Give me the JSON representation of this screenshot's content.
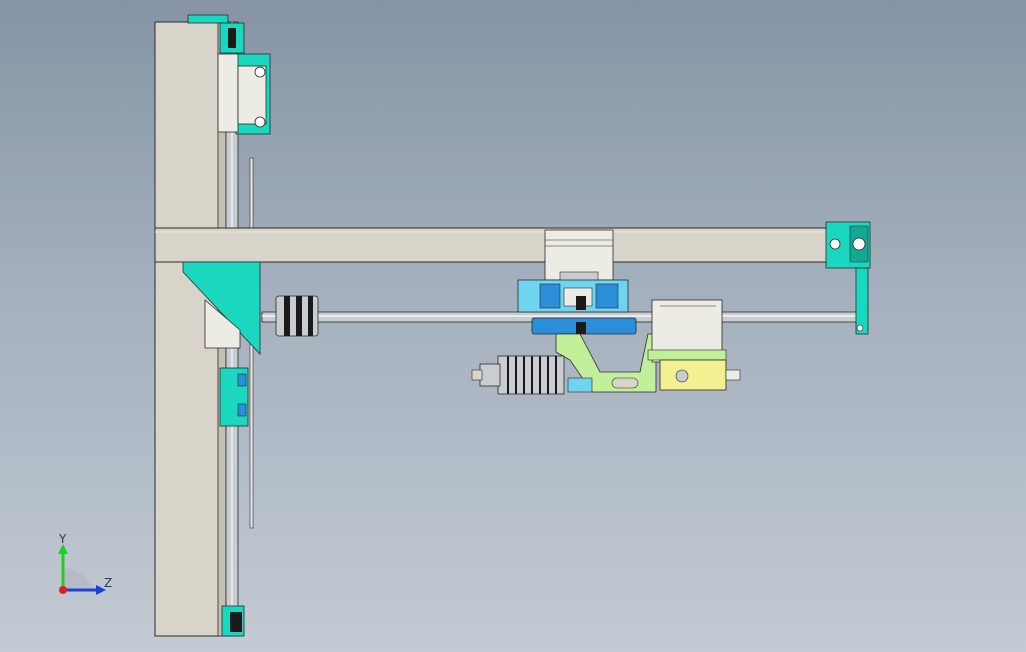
{
  "viewport": {
    "background_top": "#8694a5",
    "background_bottom": "#c3cbd4"
  },
  "colors": {
    "frame": "#d8d4c9",
    "frame_shade": "#c4c0b4",
    "edge": "#2a2a2a",
    "teal_part": "#1ad8c0",
    "teal_dark": "#12a894",
    "cyan_block": "#6fd4f0",
    "blue_block": "#2a8fd8",
    "lime_bracket": "#c2ef9a",
    "yellow_plate": "#f2f090",
    "motor_body": "#ecebe4",
    "rod": "#c9cdd2",
    "black": "#1a1a1a"
  },
  "triad": {
    "y_label": "Y",
    "z_label": "Z",
    "y_color": "#1fd01f",
    "z_color": "#1f3fe0",
    "x_color": "#e02020",
    "icon": "axis-triad-icon"
  }
}
